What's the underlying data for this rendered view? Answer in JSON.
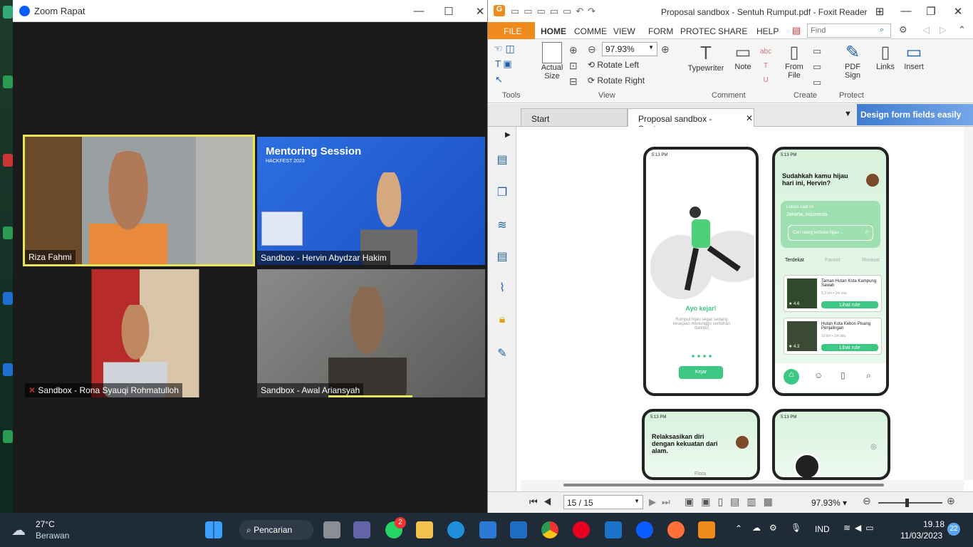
{
  "zoom": {
    "title": "Zoom Rapat",
    "participants": [
      {
        "name": "Riza Fahmi"
      },
      {
        "name": "Sandbox - Hervin Abydzar Hakim",
        "slide_title": "Mentoring Session",
        "slide_sub": "HACKFEST 2023"
      },
      {
        "name": "Sandbox - Rona Syauqi Rohmatulloh"
      },
      {
        "name": "Sandbox - Awal Ariansyah"
      }
    ]
  },
  "foxit": {
    "title": "Proposal sandbox - Sentuh Rumput.pdf - Foxit Reader",
    "menu": [
      "FILE",
      "HOME",
      "COMME",
      "VIEW",
      "FORM",
      "PROTEC",
      "SHARE",
      "HELP"
    ],
    "find_placeholder": "Find",
    "ribbon": {
      "actual_size": "Actual Size",
      "zoom": "97.93%",
      "rotate_left": "Rotate Left",
      "rotate_right": "Rotate Right",
      "typewriter": "Typewriter",
      "note": "Note",
      "from_file": "From File",
      "pdf_sign": "PDF Sign",
      "links": "Links",
      "insert": "Insert",
      "groups": {
        "tools": "Tools",
        "view": "View",
        "comment": "Comment",
        "create": "Create",
        "protect": "Protect"
      }
    },
    "tabs": {
      "start": "Start",
      "doc": "Proposal sandbox - Sentu...",
      "ad": "Design form fields easily"
    },
    "phones": {
      "p1_title": "Ayo kejar!",
      "p1_text": "Rumput hijau segar sedang kesepian menunggu sentuhan darimu!",
      "p1_btn": "Kejar",
      "time": "5:13 PM",
      "p2_title": "Sudahkah kamu hijau hari ini, Hervin?",
      "p2_loc_label": "Lokasi saat ini",
      "p2_loc": "Jakarta, Indonesia",
      "p2_search": "Cari ruang terbuka hijau ...",
      "p2_tabs": [
        "Terdekat",
        "Favorit",
        "Riwayat"
      ],
      "p2_items": [
        {
          "name": "Taman Hutan Kota Kampung Sawah",
          "meta": "5,3 km • 1m lalu",
          "rating": "4.6",
          "btn": "Lihat rute"
        },
        {
          "name": "Hutan Kota Kebon Pisang Penjalingan",
          "meta": "10 km • 1m lalu",
          "rating": "4.3",
          "btn": "Lihat rute"
        }
      ],
      "p3_title": "Relaksasikan diri dengan kekuatan dari alam.",
      "p3_sub": "Flora"
    },
    "status": {
      "page": "15 / 15",
      "zoom": "97.93%"
    }
  },
  "taskbar": {
    "weather_temp": "27°C",
    "weather_desc": "Berawan",
    "search": "Pencarian",
    "lang": "IND",
    "time": "19.18",
    "date": "11/03/2023",
    "notif": "22",
    "wa_badge": "2"
  }
}
